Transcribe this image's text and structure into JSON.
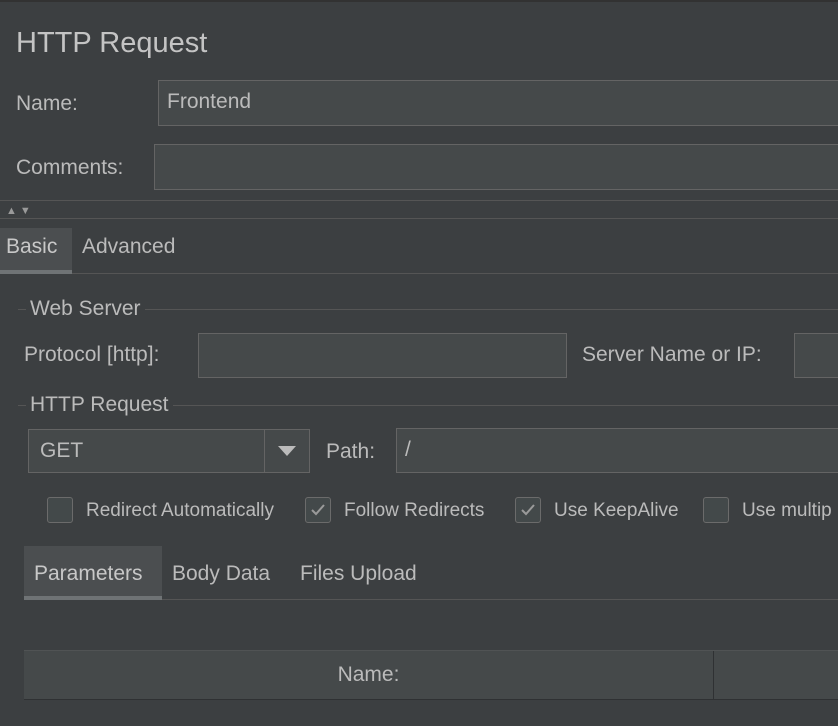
{
  "panel": {
    "title": "HTTP Request"
  },
  "form": {
    "name_label": "Name:",
    "name_value": "Frontend",
    "comments_label": "Comments:",
    "comments_value": ""
  },
  "tabs": [
    {
      "label": "Basic",
      "selected": true
    },
    {
      "label": "Advanced",
      "selected": false
    }
  ],
  "web_server": {
    "group_title": "Web Server",
    "protocol_label": "Protocol [http]:",
    "protocol_value": "",
    "server_label": "Server Name or IP:",
    "server_value": ""
  },
  "http_request": {
    "group_title": "HTTP Request",
    "method_selected": "GET",
    "path_label": "Path:",
    "path_value": "/"
  },
  "options": [
    {
      "label": "Redirect Automatically",
      "checked": false
    },
    {
      "label": "Follow Redirects",
      "checked": true
    },
    {
      "label": "Use KeepAlive",
      "checked": true
    },
    {
      "label": "Use multip",
      "checked": false
    }
  ],
  "sub_tabs": [
    {
      "label": "Parameters",
      "selected": true
    },
    {
      "label": "Body Data",
      "selected": false
    },
    {
      "label": "Files Upload",
      "selected": false
    }
  ],
  "parameters_table": {
    "columns": [
      "Name:",
      ""
    ]
  },
  "colors": {
    "background": "#3c3f41",
    "field": "#45494a",
    "border": "#646464",
    "text": "#bbbbbb"
  }
}
